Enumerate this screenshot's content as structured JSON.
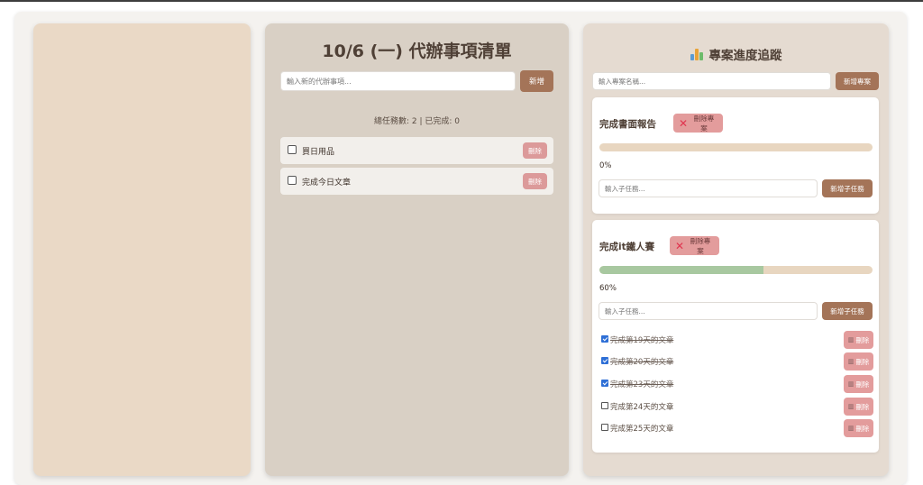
{
  "todo": {
    "title": "10/6 (一) 代辦事項清單",
    "input_placeholder": "輸入新的代辦事項...",
    "add_label": "新增",
    "stats": "總任務數: 2 | 已完成: 0",
    "items": [
      {
        "text": "買日用品",
        "done": false,
        "delete_label": "刪除"
      },
      {
        "text": "完成今日文章",
        "done": false,
        "delete_label": "刪除"
      }
    ]
  },
  "projects": {
    "title": "專案進度追蹤",
    "icon": "bar-chart-icon",
    "input_placeholder": "輸入專案名稱...",
    "add_label": "新增專案",
    "list": [
      {
        "name": "完成書面報告",
        "delete_label": "刪除專案",
        "progress": 0,
        "progress_text": "0%",
        "subtask_placeholder": "輸入子任務...",
        "add_subtask_label": "新增子任務",
        "subtasks": []
      },
      {
        "name": "完成it鐵人賽",
        "delete_label": "刪除專案",
        "progress": 60,
        "progress_text": "60%",
        "subtask_placeholder": "輸入子任務...",
        "add_subtask_label": "新增子任務",
        "subtasks": [
          {
            "text": "完成第19天的文章",
            "done": true,
            "delete_label": "刪除"
          },
          {
            "text": "完成第20天的文章",
            "done": true,
            "delete_label": "刪除"
          },
          {
            "text": "完成第23天的文章",
            "done": true,
            "delete_label": "刪除"
          },
          {
            "text": "完成第24天的文章",
            "done": false,
            "delete_label": "刪除"
          },
          {
            "text": "完成第25天的文章",
            "done": false,
            "delete_label": "刪除"
          }
        ]
      }
    ]
  },
  "colors": {
    "accent": "#a47458",
    "danger": "#dc9a9a",
    "progress_fill": "#a8c8a0",
    "progress_track": "#e8d6c0"
  }
}
